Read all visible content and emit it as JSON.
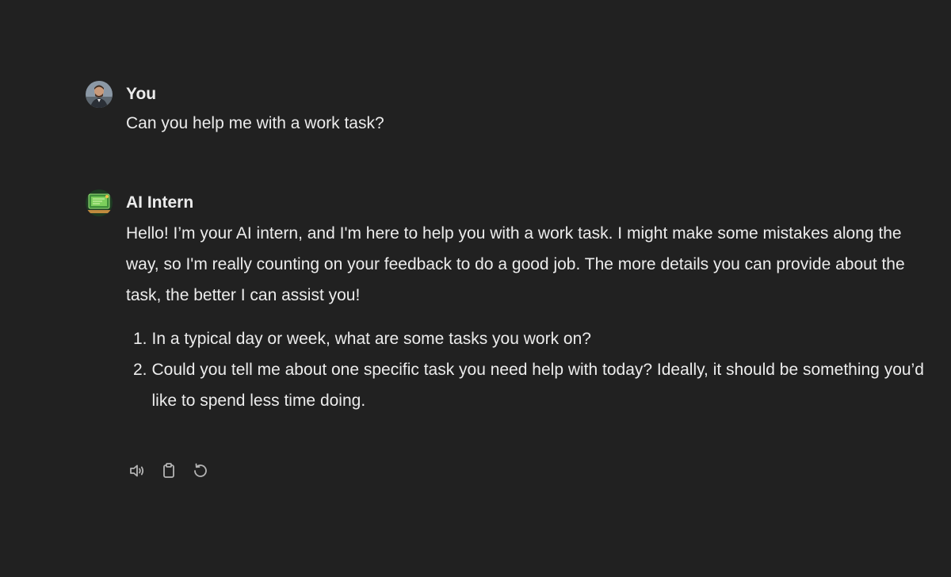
{
  "conversation": {
    "user_message": {
      "author": "You",
      "avatar_icon": "user-photo-avatar",
      "text": "Can you help me with a work task?"
    },
    "assistant_message": {
      "author": "AI Intern",
      "avatar_icon": "ai-intern-avatar",
      "intro": "Hello! I’m your AI intern, and I'm here to help you with a work task. I might make some mistakes along the way, so I'm really counting on your feedback to do a good job. The more details you can provide about the task, the better I can assist you!",
      "questions": [
        {
          "number": "1.",
          "text": "In a typical day or week, what are some tasks you work on?"
        },
        {
          "number": "2.",
          "text": "Could you tell me about one specific task you need help with today? Ideally, it should be something you’d like to spend less time doing."
        }
      ]
    },
    "actions": [
      {
        "name": "read-aloud",
        "icon": "speaker-icon"
      },
      {
        "name": "copy",
        "icon": "clipboard-icon"
      },
      {
        "name": "regenerate",
        "icon": "refresh-icon"
      }
    ]
  },
  "colors": {
    "background": "#212121",
    "text": "#ececec",
    "icon": "#b4b4b4"
  }
}
